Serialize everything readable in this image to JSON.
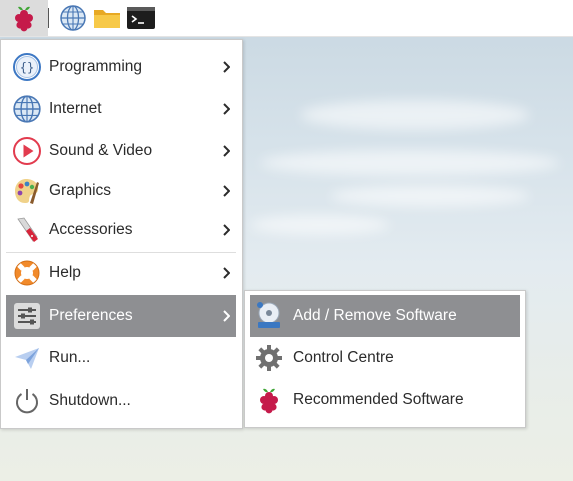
{
  "taskbar": {
    "items": [
      {
        "name": "raspberry-menu",
        "icon": "raspberry-icon"
      },
      {
        "name": "web-browser",
        "icon": "globe-icon"
      },
      {
        "name": "file-manager",
        "icon": "folder-icon"
      },
      {
        "name": "terminal",
        "icon": "terminal-icon"
      }
    ]
  },
  "menu": {
    "items": [
      {
        "label": "Programming",
        "icon": "programming-icon",
        "submenu": true
      },
      {
        "label": "Internet",
        "icon": "globe-icon",
        "submenu": true
      },
      {
        "label": "Sound & Video",
        "icon": "play-icon",
        "submenu": true
      },
      {
        "label": "Graphics",
        "icon": "palette-icon",
        "submenu": true
      },
      {
        "label": "Accessories",
        "icon": "knife-icon",
        "submenu": true
      },
      {
        "label": "Help",
        "icon": "lifebuoy-icon",
        "submenu": true
      },
      {
        "label": "Preferences",
        "icon": "sliders-icon",
        "submenu": true,
        "active": true
      },
      {
        "label": "Run...",
        "icon": "paper-plane-icon",
        "submenu": false
      },
      {
        "label": "Shutdown...",
        "icon": "power-icon",
        "submenu": false
      }
    ]
  },
  "submenu": {
    "items": [
      {
        "label": "Add / Remove Software",
        "icon": "disc-install-icon",
        "active": true
      },
      {
        "label": "Control Centre",
        "icon": "gear-icon"
      },
      {
        "label": "Recommended Software",
        "icon": "raspberry-icon"
      }
    ]
  },
  "colors": {
    "highlight": "#8e8f92",
    "text": "#2b2b2b",
    "raspberry": "#c51a4a"
  }
}
